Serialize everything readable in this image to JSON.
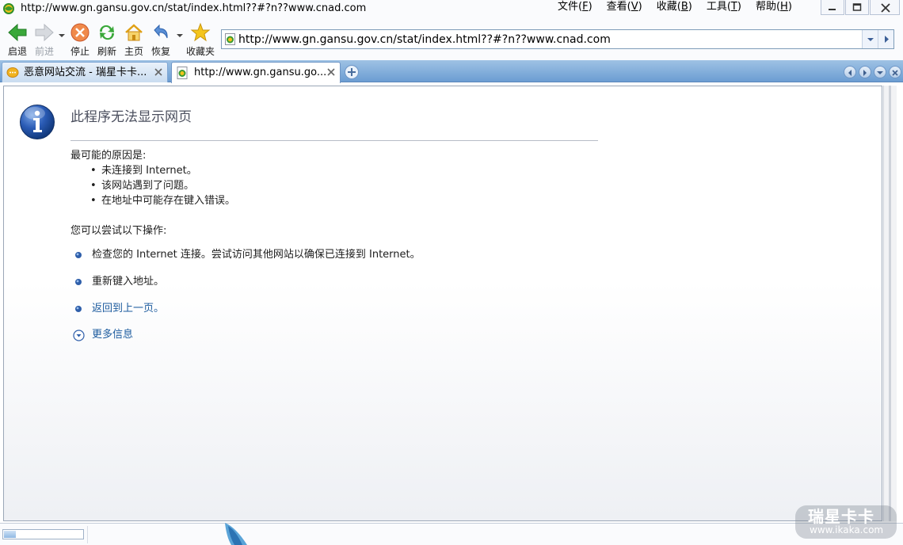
{
  "window": {
    "title": "http://www.gn.gansu.gov.cn/stat/index.html??#?n??www.cnad.com"
  },
  "menu": [
    {
      "label": "文件",
      "key": "F"
    },
    {
      "label": "查看",
      "key": "V"
    },
    {
      "label": "收藏",
      "key": "B"
    },
    {
      "label": "工具",
      "key": "T"
    },
    {
      "label": "帮助",
      "key": "H"
    }
  ],
  "toolbar": {
    "back_label": "启退",
    "forward_label": "前进",
    "stop_label": "停止",
    "refresh_label": "刷新",
    "home_label": "主页",
    "restore_label": "恢复",
    "favorites_label": "收藏夹"
  },
  "address": {
    "value": "http://www.gn.gansu.gov.cn/stat/index.html??#?n??www.cnad.com"
  },
  "tabs": [
    {
      "title": "恶意网站交流 - 瑞星卡卡...",
      "active": false
    },
    {
      "title": "http://www.gn.gansu.go...",
      "active": true
    }
  ],
  "error_page": {
    "title": "此程序无法显示网页",
    "causes_heading": "最可能的原因是:",
    "causes": [
      "未连接到 Internet。",
      "该网站遇到了问题。",
      "在地址中可能存在键入错误。"
    ],
    "actions_heading": "您可以尝试以下操作:",
    "actions": [
      {
        "text": "检查您的 Internet 连接。尝试访问其他网站以确保已连接到 Internet。",
        "link": false
      },
      {
        "text": "重新键入地址。",
        "link": false
      },
      {
        "text": "返回到上一页。",
        "link": true
      }
    ],
    "more_info": "更多信息"
  },
  "status": {
    "progress": 0.15
  },
  "watermark": {
    "brand": "瑞星卡卡",
    "url": "www.ikaka.com"
  },
  "colors": {
    "link": "#1c5b9e",
    "tabstrip": "#7ba9d8",
    "info_icon": "#1f4fa0"
  }
}
